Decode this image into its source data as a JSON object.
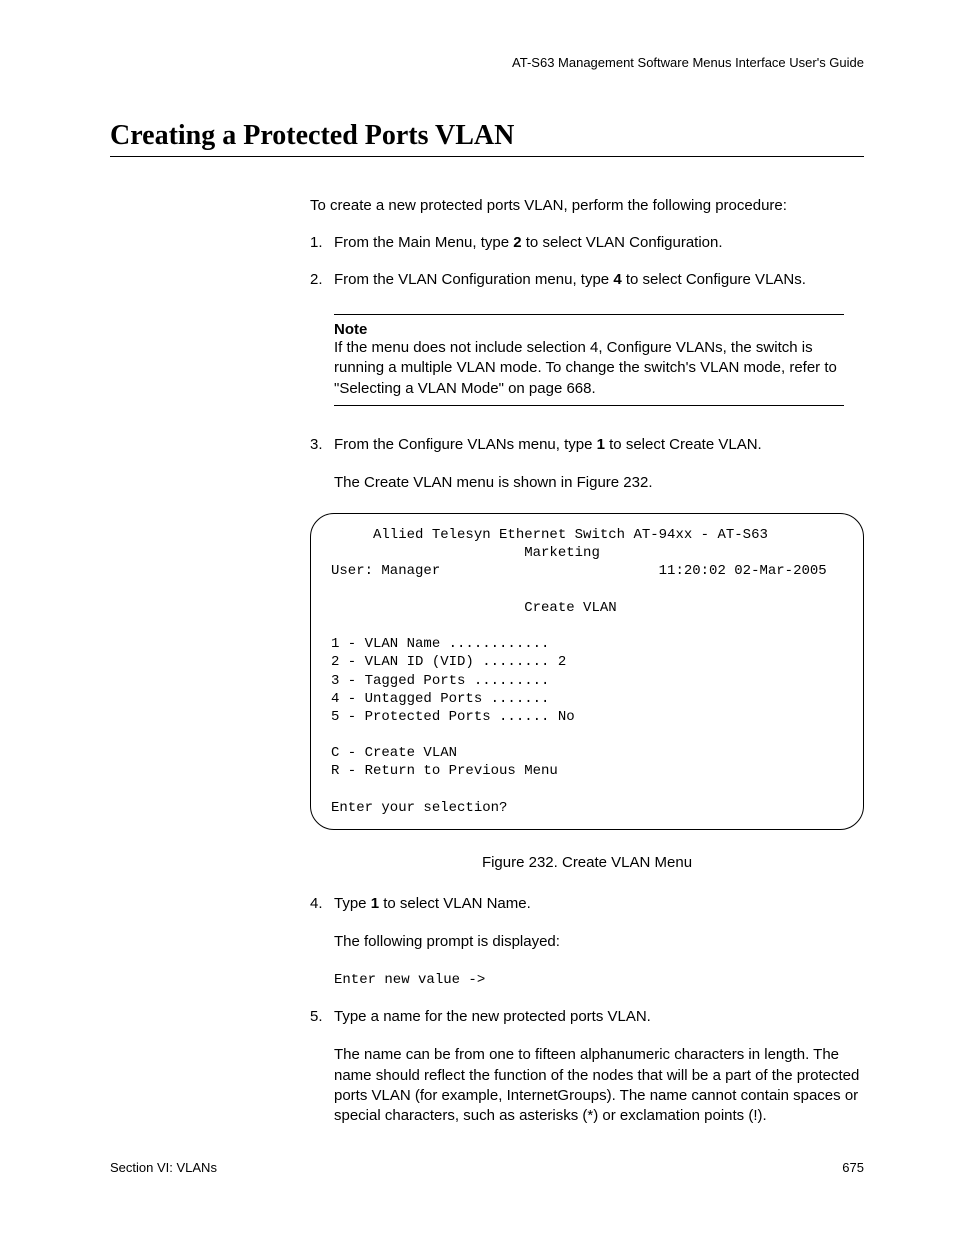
{
  "header": "AT-S63 Management Software Menus Interface User's Guide",
  "heading": "Creating a Protected Ports VLAN",
  "intro": "To create a new protected ports VLAN, perform the following procedure:",
  "step1_num": "1.",
  "step1_a": "From the Main Menu, type ",
  "step1_b": "2",
  "step1_c": " to select VLAN Configuration.",
  "step2_num": "2.",
  "step2_a": "From the VLAN Configuration menu, type ",
  "step2_b": "4",
  "step2_c": " to select Configure VLANs.",
  "note_label": "Note",
  "note_text": "If the menu does not include selection 4, Configure VLANs, the switch is running a multiple VLAN mode. To change the switch's VLAN mode, refer to \"Selecting a VLAN Mode\" on page 668.",
  "step3_num": "3.",
  "step3_a": "From the Configure VLANs menu, type ",
  "step3_b": "1",
  "step3_c": " to select Create VLAN.",
  "step3_sub": "The Create VLAN menu is shown in Figure 232.",
  "terminal": "     Allied Telesyn Ethernet Switch AT-94xx - AT-S63\n                       Marketing\nUser: Manager                          11:20:02 02-Mar-2005\n\n                       Create VLAN\n\n1 - VLAN Name ............\n2 - VLAN ID (VID) ........ 2\n3 - Tagged Ports .........\n4 - Untagged Ports .......\n5 - Protected Ports ...... No\n\nC - Create VLAN\nR - Return to Previous Menu\n\nEnter your selection?",
  "figure_caption": "Figure 232. Create VLAN Menu",
  "step4_num": "4.",
  "step4_a": "Type ",
  "step4_b": "1",
  "step4_c": " to select VLAN Name.",
  "step4_sub": "The following prompt is displayed:",
  "prompt": "Enter new value ->",
  "step5_num": "5.",
  "step5_text": "Type a name for the new protected ports VLAN.",
  "step5_sub": "The name can be from one to fifteen alphanumeric characters in length. The name should reflect the function of the nodes that will be a part of the protected ports VLAN (for example, InternetGroups). The name cannot contain spaces or special characters, such as asterisks (*) or exclamation points (!).",
  "footer_left": "Section VI: VLANs",
  "footer_right": "675"
}
